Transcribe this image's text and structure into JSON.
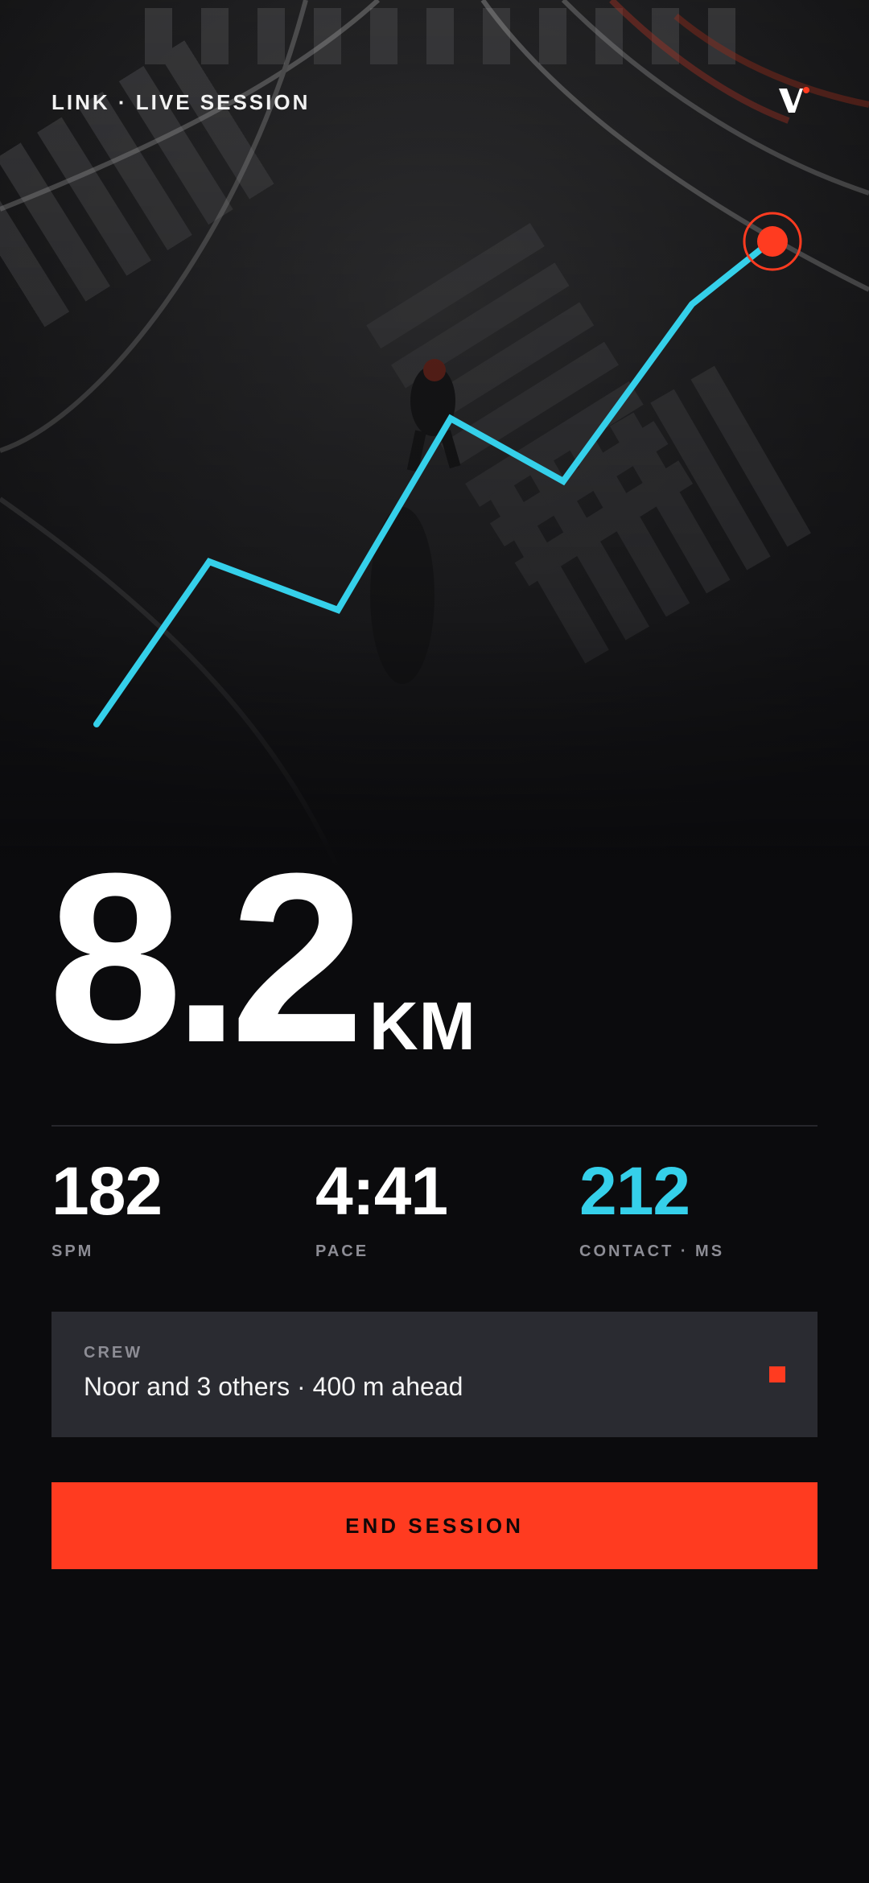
{
  "header": {
    "title": "LINK · LIVE SESSION",
    "logo": "brand-v-logo"
  },
  "hero": {
    "image": "runner-crosswalk-photo",
    "route_color": "#35d0ea",
    "marker_color": "#ff3b20"
  },
  "distance": {
    "value": "8.2",
    "unit": "KM"
  },
  "metrics": [
    {
      "value": "182",
      "label": "SPM"
    },
    {
      "value": "4:41",
      "label": "PACE"
    },
    {
      "value": "212",
      "label": "CONTACT · MS",
      "color": "#35d0ea"
    }
  ],
  "crew": {
    "label": "CREW",
    "text": "Noor and 3 others · 400 m ahead",
    "status_color": "#ff3b20"
  },
  "actions": {
    "end_label": "END SESSION",
    "color": "#ff3b20"
  }
}
